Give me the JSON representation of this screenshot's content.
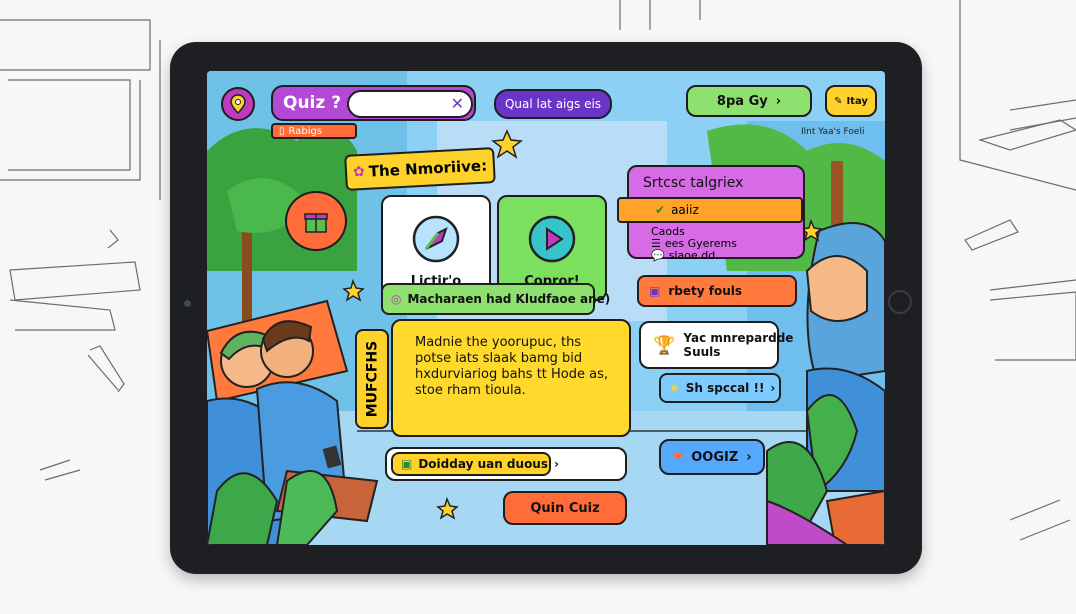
{
  "topbar": {
    "quiz_title": "Quiz ?",
    "quiz_input_value": "",
    "clear_symbol": "✕",
    "tag_label": "Rabigs",
    "center_chip": "Qual lat aigs eis",
    "spa_label": "8pa Gy",
    "spa_arrow": "›",
    "pencil_label": "Itay",
    "corner_note": "Ilnt Yaa's Foeli"
  },
  "heading": {
    "title": "The Nmoriive:",
    "star": "★"
  },
  "options": [
    {
      "label": "Lictir'o",
      "icon": "compass-icon"
    },
    {
      "label": "Copror!",
      "icon": "play-icon"
    }
  ],
  "strategy": {
    "title": "Srtcsc talgriex",
    "highlight": "aaiiz",
    "lines": [
      "Caods",
      "ees Gyerems",
      "slaoe dd."
    ]
  },
  "match_bar": "Macharaen had Kludfaoe ane)",
  "body_button": "rbety fouls",
  "side_tag": "MUFCFHS",
  "passage": [
    "Madnie the yoorupuc, ths",
    "potse iats slaak bamg bid",
    "hxdurviariog bahs tt Hode as,",
    "stoe rham tioula."
  ],
  "tip": {
    "line1": "Yac mnrepardde",
    "line2": "Suuls"
  },
  "special_button": "Sh spccal !!",
  "special_arrow": "›",
  "oogiz_button": "OOGIZ",
  "oogiz_arrow": "›",
  "daily": {
    "label": "Doidday uan duous",
    "arrow": "›"
  },
  "quit_button": "Quin Cuiz",
  "colors": {
    "accent_purple": "#b347d6",
    "accent_green": "#8ee06f",
    "accent_yellow": "#ffd22b",
    "accent_orange": "#ff6c3a",
    "accent_blue": "#54a9ff"
  }
}
